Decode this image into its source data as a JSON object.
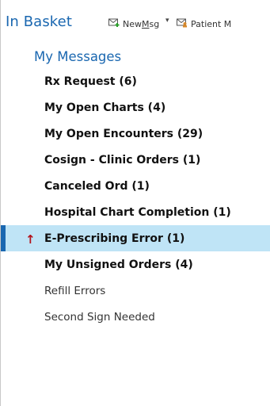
{
  "header": {
    "title": "In Basket",
    "new_msg_prefix": "New ",
    "new_msg_underlined": "M",
    "new_msg_suffix": "sg",
    "dropdown_glyph": "▾",
    "patient_msg": "Patient M",
    "icons": [
      "new-message-icon",
      "patient-message-icon"
    ]
  },
  "section": {
    "title": "My Messages"
  },
  "folders": [
    {
      "label": "Rx Request (6)",
      "style": "bold"
    },
    {
      "label": "My Open Charts (4)",
      "style": "bold"
    },
    {
      "label": "My Open Encounters (29)",
      "style": "bold"
    },
    {
      "label": "Cosign - Clinic Orders (1)",
      "style": "bold"
    },
    {
      "label": "Canceled Ord (1)",
      "style": "bold"
    },
    {
      "label": "Hospital Chart Completion (1)",
      "style": "bold"
    },
    {
      "label": "E-Prescribing Error (1)",
      "style": "bold",
      "selected": true,
      "flag": "↑"
    },
    {
      "label": "My Unsigned Orders (4)",
      "style": "bold"
    },
    {
      "label": "Refill Errors",
      "style": "normal"
    },
    {
      "label": "Second Sign Needed",
      "style": "normal"
    }
  ],
  "colors": {
    "accent": "#1a67b0",
    "selection": "#bfe4f6",
    "flag": "#b3121b"
  }
}
